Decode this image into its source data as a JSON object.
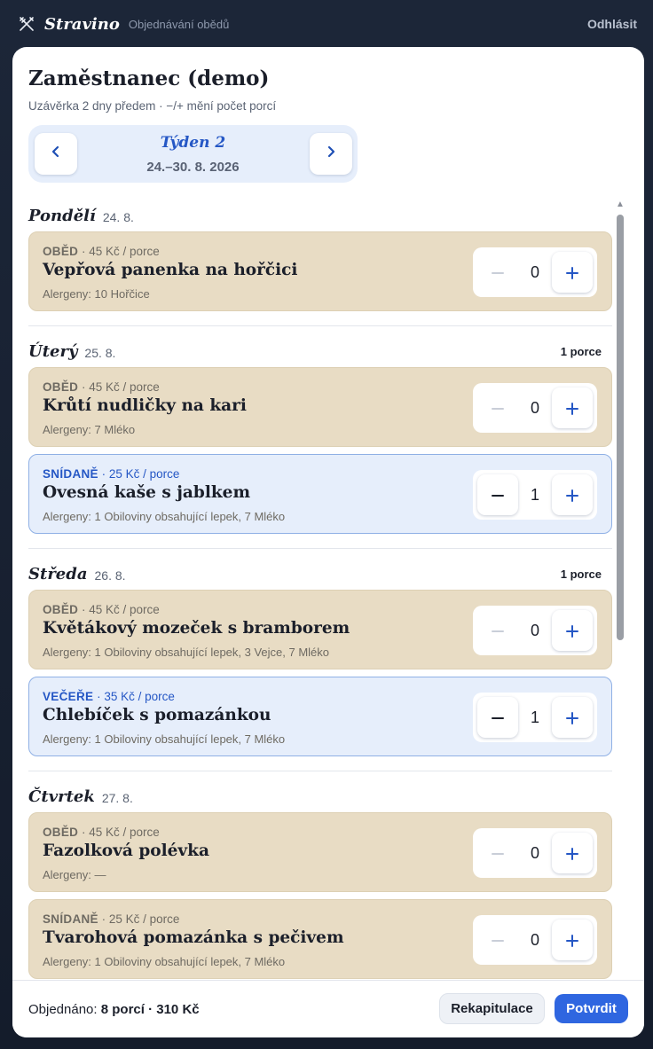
{
  "app": {
    "brand": "Stravino",
    "subtitle": "Objednávání obědů",
    "logout_label": "Odhlásit"
  },
  "page": {
    "title": "Zaměstnanec (demo)",
    "subtitle": "Uzávěrka 2 dny předem · −/+ mění počet porcí"
  },
  "week_nav": {
    "label": "Týden 2",
    "range": "24.–30. 8. 2026"
  },
  "days": [
    {
      "name": "Pondělí",
      "date": "24. 8.",
      "count": "",
      "meals": [
        {
          "kind": "OBĚD",
          "price": " · 45 Kč / porce",
          "name": "Vepřová panenka na hořčici",
          "allergens": "Alergeny: 10 Hořčice",
          "qty": "0",
          "selected": false
        }
      ]
    },
    {
      "name": "Úterý",
      "date": "25. 8.",
      "count": "1 porce",
      "meals": [
        {
          "kind": "OBĚD",
          "price": " · 45 Kč / porce",
          "name": "Krůtí nudličky na kari",
          "allergens": "Alergeny: 7 Mléko",
          "qty": "0",
          "selected": false
        },
        {
          "kind": "SNÍDANĚ",
          "price": " · 25 Kč / porce",
          "name": "Ovesná kaše s jablkem",
          "allergens": "Alergeny: 1 Obiloviny obsahující lepek, 7 Mléko",
          "qty": "1",
          "selected": true
        }
      ]
    },
    {
      "name": "Středa",
      "date": "26. 8.",
      "count": "1 porce",
      "meals": [
        {
          "kind": "OBĚD",
          "price": " · 45 Kč / porce",
          "name": "Květákový mozeček s bramborem",
          "allergens": "Alergeny: 1 Obiloviny obsahující lepek, 3 Vejce, 7 Mléko",
          "qty": "0",
          "selected": false
        },
        {
          "kind": "VEČEŘE",
          "price": " · 35 Kč / porce",
          "name": "Chlebíček s pomazánkou",
          "allergens": "Alergeny: 1 Obiloviny obsahující lepek, 7 Mléko",
          "qty": "1",
          "selected": true
        }
      ]
    },
    {
      "name": "Čtvrtek",
      "date": "27. 8.",
      "count": "",
      "meals": [
        {
          "kind": "OBĚD",
          "price": " · 45 Kč / porce",
          "name": "Fazolková polévka",
          "allergens": "Alergeny: —",
          "qty": "0",
          "selected": false
        },
        {
          "kind": "SNÍDANĚ",
          "price": " · 25 Kč / porce",
          "name": "Tvarohová pomazánka s pečivem",
          "allergens": "Alergeny: 1 Obiloviny obsahující lepek, 7 Mléko",
          "qty": "0",
          "selected": false
        }
      ]
    }
  ],
  "footer": {
    "ordered_label": "Objednáno: ",
    "ordered_value": "8 porcí · 310 Kč",
    "recap_label": "Rekapitulace",
    "confirm_label": "Potvrdit"
  },
  "icons": {
    "logo": "cutlery-cross-icon",
    "prev": "chevron-left-icon",
    "next": "chevron-right-icon",
    "minus": "minus-icon",
    "plus": "plus-icon"
  },
  "colors": {
    "accent": "#2f66e0",
    "meal_card": "#e8dcc4",
    "selected_card": "#e6eefb"
  }
}
